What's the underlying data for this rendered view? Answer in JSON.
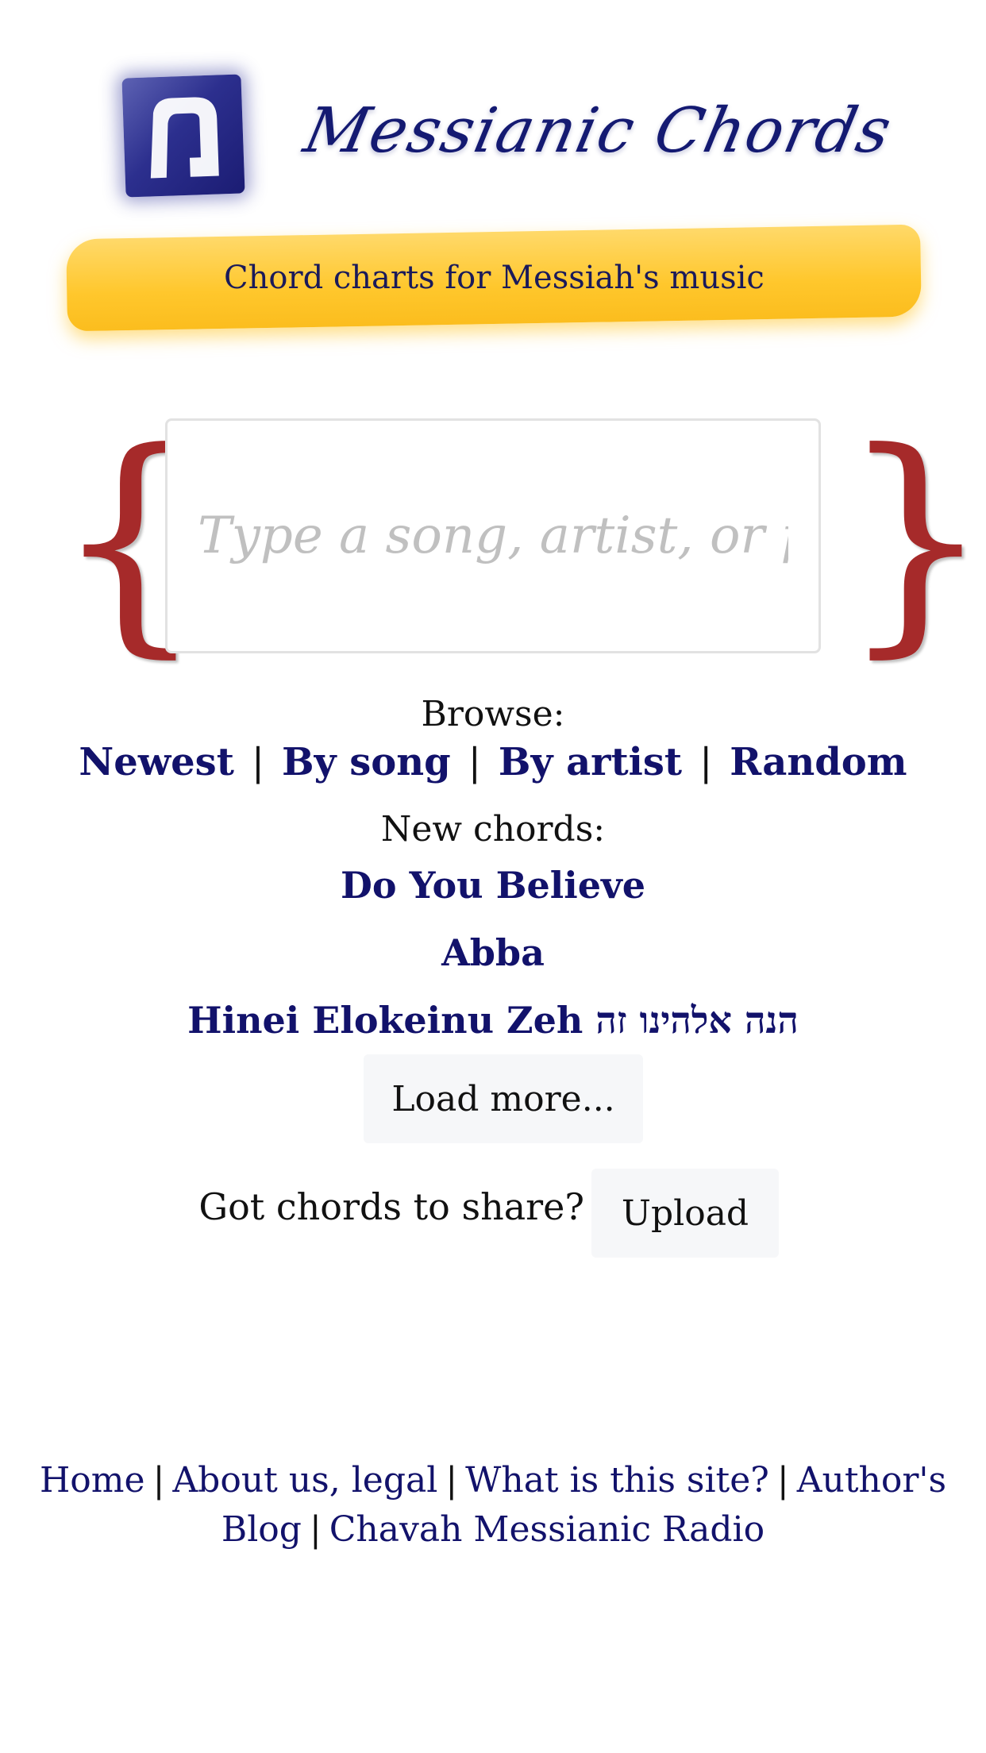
{
  "header": {
    "logo_glyph": "מ",
    "title": "Messianic Chords",
    "tagline": "Chord charts for Messiah's music"
  },
  "colors": {
    "logo_blue": "#2c2f8e",
    "title_navy": "#141a72",
    "banner_yellow": "#ffc72c",
    "brace_red": "#a62a2a",
    "link_navy": "#12126b",
    "button_gray": "#f6f7f9"
  },
  "search": {
    "placeholder": "Type a song, artist, or phrase",
    "value": "",
    "brace_left": "{",
    "brace_right": "}"
  },
  "browse": {
    "label": "Browse:",
    "separator": "|",
    "links": [
      {
        "label": "Newest"
      },
      {
        "label": "By song"
      },
      {
        "label": "By artist"
      },
      {
        "label": "Random"
      }
    ]
  },
  "new_chords": {
    "label": "New chords:",
    "songs": [
      {
        "title": "Do You Believe"
      },
      {
        "title": "Abba"
      },
      {
        "title": "Hinei Elokeinu Zeh הנה אלהינו זה"
      }
    ],
    "load_more_label": "Load more..."
  },
  "share": {
    "prompt": "Got chords to share?",
    "upload_label": "Upload"
  },
  "footer": {
    "separator": "|",
    "links": [
      {
        "label": "Home"
      },
      {
        "label": "About us, legal"
      },
      {
        "label": "What is this site?"
      },
      {
        "label": "Author's Blog"
      },
      {
        "label": "Chavah Messianic Radio"
      }
    ]
  }
}
